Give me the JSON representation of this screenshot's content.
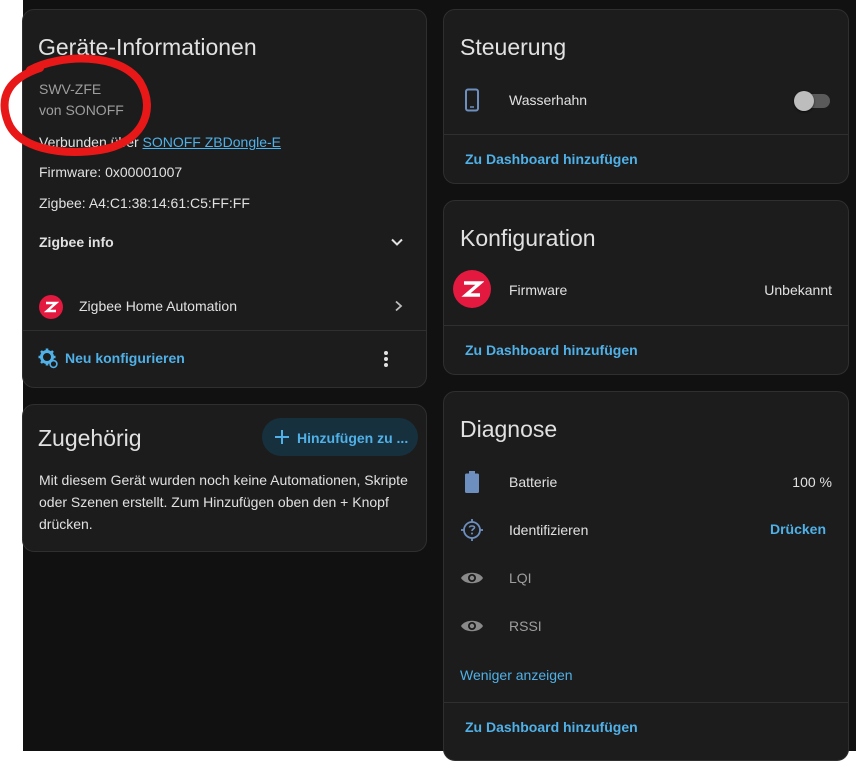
{
  "device_info": {
    "title": "Geräte-Informationen",
    "model": "SWV-ZFE",
    "manufacturer": "von SONOFF",
    "via_prefix": "Verbunden über ",
    "via_link": "SONOFF ZBDongle-E",
    "firmware": "Firmware: 0x00001007",
    "zigbee": "Zigbee: A4:C1:38:14:61:C5:FF:FF",
    "zigbee_info": "Zigbee info",
    "integration": "Zigbee Home Automation",
    "reconfigure": "Neu konfigurieren"
  },
  "related": {
    "title": "Zugehörig",
    "add_button": "Hinzufügen zu ...",
    "description_line1": "Mit diesem Gerät wurden noch keine Automationen, Skripte",
    "description_line2": "oder Szenen erstellt. Zum Hinzufügen oben den + Knopf",
    "description_line3": "drücken."
  },
  "controls": {
    "title": "Steuerung",
    "entity": "Wasserhahn",
    "toggle_on": false,
    "add_dashboard": "Zu Dashboard hinzufügen"
  },
  "configuration": {
    "title": "Konfiguration",
    "entity": "Firmware",
    "value": "Unbekannt",
    "add_dashboard": "Zu Dashboard hinzufügen"
  },
  "diagnostics": {
    "title": "Diagnose",
    "battery_label": "Batterie",
    "battery_value": "100 %",
    "identify_label": "Identifizieren",
    "identify_action": "Drücken",
    "lqi_label": "LQI",
    "rssi_label": "RSSI",
    "show_less": "Weniger anzeigen",
    "add_dashboard": "Zu Dashboard hinzufügen"
  },
  "colors": {
    "accent": "#4fb1e8",
    "zigbee_red": "#e3193f",
    "annotation_red": "#e81818",
    "entity_icon": "#6d8fbf"
  }
}
